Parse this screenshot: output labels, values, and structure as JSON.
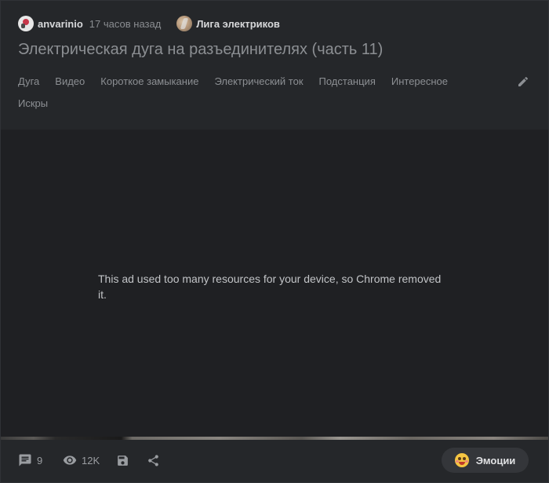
{
  "post": {
    "author": "anvarinio",
    "time": "17 часов назад",
    "community": "Лига электриков",
    "title": "Электрическая дуга на разъединителях (часть 11)",
    "tags": [
      "Дуга",
      "Видео",
      "Короткое замыкание",
      "Электрический ток",
      "Подстанция",
      "Интересное",
      "Искры"
    ]
  },
  "media": {
    "ad_message": "This ad used too many resources for your device, so Chrome removed it."
  },
  "footer": {
    "comments_count": "9",
    "views_count": "12K",
    "emotions_label": "Эмоции"
  },
  "icons": {
    "comments": "comment-icon",
    "views": "eye-icon",
    "save": "save-icon",
    "share": "share-icon",
    "edit": "pencil-icon"
  },
  "colors": {
    "background": "#25272a",
    "media_background": "#1f2023",
    "muted_text": "#8c8f93",
    "emotion_button": "#34363a"
  }
}
